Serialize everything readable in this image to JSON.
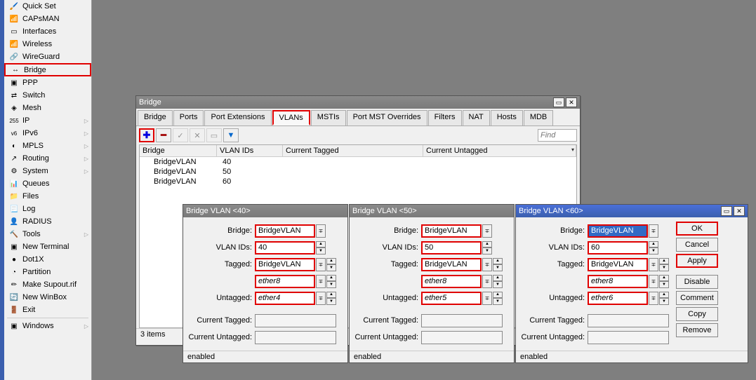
{
  "sidebar": {
    "items": [
      {
        "label": "Quick Set",
        "icon": "🖌️"
      },
      {
        "label": "CAPsMAN",
        "icon": "📶"
      },
      {
        "label": "Interfaces",
        "icon": "▭"
      },
      {
        "label": "Wireless",
        "icon": "📶"
      },
      {
        "label": "WireGuard",
        "icon": "🔗"
      },
      {
        "label": "Bridge",
        "icon": "↔"
      },
      {
        "label": "PPP",
        "icon": "▣"
      },
      {
        "label": "Switch",
        "icon": "⇄"
      },
      {
        "label": "Mesh",
        "icon": "◈"
      },
      {
        "label": "IP",
        "icon": "255",
        "arrow": true
      },
      {
        "label": "IPv6",
        "icon": "v6",
        "arrow": true
      },
      {
        "label": "MPLS",
        "icon": "◐",
        "arrow": true
      },
      {
        "label": "Routing",
        "icon": "↗",
        "arrow": true
      },
      {
        "label": "System",
        "icon": "⚙",
        "arrow": true
      },
      {
        "label": "Queues",
        "icon": "📊"
      },
      {
        "label": "Files",
        "icon": "📁"
      },
      {
        "label": "Log",
        "icon": "📃"
      },
      {
        "label": "RADIUS",
        "icon": "👤"
      },
      {
        "label": "Tools",
        "icon": "🔨",
        "arrow": true
      },
      {
        "label": "New Terminal",
        "icon": "▣"
      },
      {
        "label": "Dot1X",
        "icon": "●"
      },
      {
        "label": "Partition",
        "icon": "◔"
      },
      {
        "label": "Make Supout.rif",
        "icon": "✏"
      },
      {
        "label": "New WinBox",
        "icon": "🔄"
      },
      {
        "label": "Exit",
        "icon": "🚪"
      }
    ],
    "windows_label": "Windows"
  },
  "bridge_window": {
    "title": "Bridge",
    "tabs": [
      "Bridge",
      "Ports",
      "Port Extensions",
      "VLANs",
      "MSTIs",
      "Port MST Overrides",
      "Filters",
      "NAT",
      "Hosts",
      "MDB"
    ],
    "active_tab": 3,
    "find_placeholder": "Find",
    "columns": [
      "Bridge",
      "VLAN IDs",
      "Current Tagged",
      "Current Untagged"
    ],
    "rows": [
      {
        "bridge": "BridgeVLAN",
        "vlan": "40"
      },
      {
        "bridge": "BridgeVLAN",
        "vlan": "50"
      },
      {
        "bridge": "BridgeVLAN",
        "vlan": "60"
      }
    ],
    "status": "3 items"
  },
  "dialogs": [
    {
      "title": "Bridge VLAN <40>",
      "bridge": "BridgeVLAN",
      "vlan_ids": "40",
      "tagged": [
        "BridgeVLAN",
        "ether8"
      ],
      "untagged": [
        "ether4"
      ],
      "current_tagged": "",
      "current_untagged": "",
      "status": "enabled",
      "selected": false,
      "buttons": false
    },
    {
      "title": "Bridge VLAN <50>",
      "bridge": "BridgeVLAN",
      "vlan_ids": "50",
      "tagged": [
        "BridgeVLAN",
        "ether8"
      ],
      "untagged": [
        "ether5"
      ],
      "current_tagged": "",
      "current_untagged": "",
      "status": "enabled",
      "selected": false,
      "buttons": false
    },
    {
      "title": "Bridge VLAN <60>",
      "bridge": "BridgeVLAN",
      "vlan_ids": "60",
      "tagged": [
        "BridgeVLAN",
        "ether8"
      ],
      "untagged": [
        "ether6"
      ],
      "current_tagged": "",
      "current_untagged": "",
      "status": "enabled",
      "selected": true,
      "buttons": true
    }
  ],
  "labels": {
    "bridge": "Bridge:",
    "vlan_ids": "VLAN IDs:",
    "tagged": "Tagged:",
    "untagged": "Untagged:",
    "current_tagged": "Current Tagged:",
    "current_untagged": "Current Untagged:"
  },
  "buttons": {
    "ok": "OK",
    "cancel": "Cancel",
    "apply": "Apply",
    "disable": "Disable",
    "comment": "Comment",
    "copy": "Copy",
    "remove": "Remove"
  }
}
